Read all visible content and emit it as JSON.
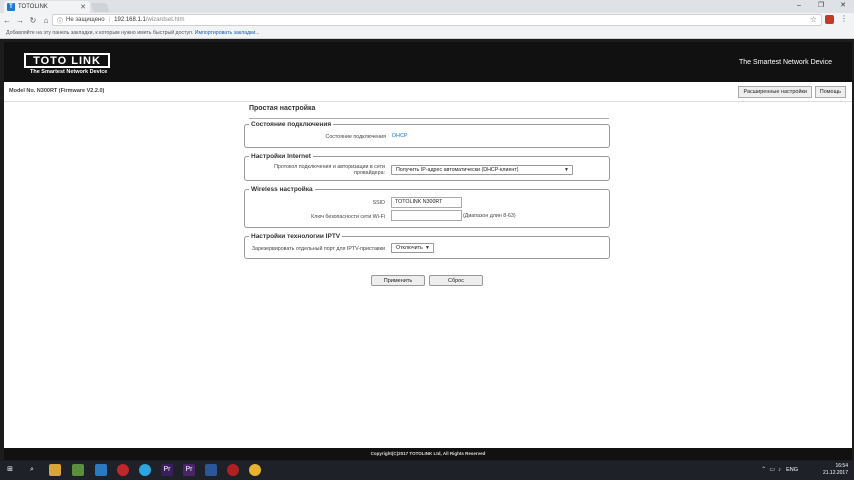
{
  "browser": {
    "tab_title": "TOTOLINK",
    "tab_favicon": "T",
    "url_security": "Не защищено",
    "url_host": "192.168.1.1",
    "url_path": "/wizardset.htm",
    "bookmarks_text": "Добавляйте на эту панель закладки, к которым нужно иметь быстрый доступ.",
    "bookmarks_link": "Импортировать закладки..."
  },
  "header": {
    "logo": "TOTO LINK",
    "logo_sub": "The Smartest Network Device",
    "tagline": "The Smartest Network Device"
  },
  "modelbar": {
    "model": "Model No. N300RT (Firmware V2.2.0)",
    "advanced_button": "Расширенные настройки",
    "help_button": "Помощь"
  },
  "main": {
    "title": "Простая настройка",
    "connection_status": {
      "legend": "Состояние подключения",
      "label": "Состояние подключения",
      "value": "DHCP"
    },
    "internet": {
      "legend": "Настройки Internet",
      "label_line1": "Протокол подключения и авторизации в сети",
      "label_line2": "провайдера:",
      "protocol_value": "Получить IP-адрес автоматически (DHCP-клиент)"
    },
    "wireless": {
      "legend": "Wireless настройка",
      "ssid_label": "SSID",
      "ssid_value": "TOTOLINK N300RT",
      "key_label": "Ключ безопасности сети Wi-Fi",
      "key_value": "",
      "key_hint": "(Диапазон длин 8-63)"
    },
    "iptv": {
      "legend": "Настройки технологии IPTV",
      "label": "Зарезервировать отдельный порт для IPTV-приставки",
      "value": "Отключить"
    },
    "apply_button": "Применить",
    "reset_button": "Сброс"
  },
  "footer": {
    "copyright": "Copyright(C)2017 TOTOLINK Ltd, All Rights Reserved"
  },
  "taskbar": {
    "lang": "ENG",
    "time": "16:54",
    "date": "21.12.2017"
  }
}
